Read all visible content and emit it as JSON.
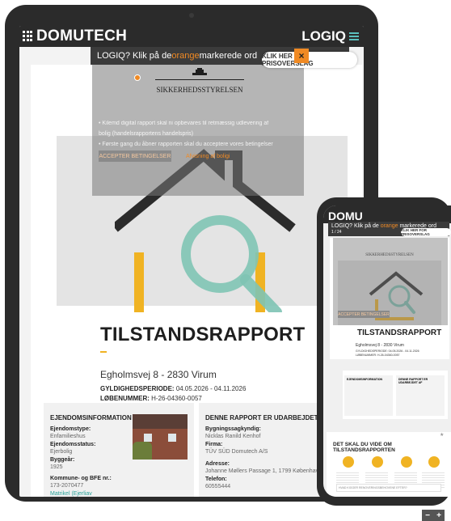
{
  "tablet": {
    "brand": "DOMUTECH",
    "logiq": "LOGIQ",
    "viewer_prefix": "LOGIQ? Klik på de ",
    "viewer_highlight": "orange",
    "viewer_suffix": " markerede ord",
    "cta_label": "KLIK HER FOR PRISOVERSLAG",
    "cta_close": "×",
    "overlay": {
      "agency": "SIKKERHEDSSTYRELSEN",
      "line1": "• Kilemd digital rapport skal ni opbevares til retmæssig udlevering af",
      "line2": "  bolig (handelsrapportens handelspris)",
      "line3": "• Første gang du åbner rapporten skal du acceptere vores betingelser",
      "accept_label": "ACCEPTER BETINGELSER",
      "decline_label": "Afvisning af boligi"
    },
    "report": {
      "title": "TILSTANDSRAPPORT",
      "address": "Egholmsvej 8 - 2830 Virum",
      "period_label": "GYLDIGHEDSPERIODE:",
      "period_value": "04.05.2026 - 04.11.2026",
      "lob_label": "LØBENUMMER:",
      "lob_value": "H-26-04360-0057"
    },
    "property_info": {
      "heading": "EJENDOMSINFORMATION",
      "type_label": "Ejendomstype:",
      "type_value": "Enfamilieshus",
      "status_label": "Ejendomsstatus:",
      "status_value": "Ejerbolig",
      "year_label": "Byggeår:",
      "year_value": "1925",
      "bfe_label": "Kommune- og BFE nr.:",
      "bfe_value": "173-2070477",
      "link": "Matrikel (Ejerliav"
    },
    "prepared_by": {
      "heading": "DENNE RAPPORT ER UDARBEJDET AF",
      "expert_label": "Bygningssagkyndig:",
      "expert_value": "Nicklas Ranild Kenhof",
      "firm_label": "Firma:",
      "firm_value": "TÜV SÜD Domutech A/S",
      "address_label": "Adresse:",
      "address_value": "Johanne Møllers Passage 1, 1799 København",
      "phone_label": "Telefon:",
      "phone_value": "60555444"
    }
  },
  "phone": {
    "brand": "DOMU",
    "viewer_prefix": "LOGIQ? Klik på de ",
    "viewer_highlight": "orange",
    "viewer_suffix": " markerede ord",
    "page_label": "1 / 24",
    "cta_label": "KLIK HER FOR PRISOVERSLAG",
    "agency": "SIKKERHEDSSTYRELSEN",
    "accept_label": "ACCEPTER BETINGELSER",
    "title": "TILSTANDSRAPPORT",
    "address": "Egholmsvej 8 - 2830 Virum",
    "period": "GYLDIGHEDSPERIODE: 04.05.2026 - 04.11.2026",
    "lob": "LØBENUMMER: H-26-04360-0057",
    "info_left": "EJENDOMSINFORMATION",
    "info_right": "DENNE RAPPORT ER UDARBEJDET AF",
    "section_title": "DET SKAL DU VIDE OM TILSTANDSRAPPORTEN",
    "search_placeholder": "HVAD KIGGER RENOVERINGSBEHOVENE EFTER?",
    "zoom_minus": "−",
    "zoom_plus": "+",
    "star": "★"
  },
  "colors": {
    "accent_orange": "#f08a24",
    "accent_yellow": "#f0b323",
    "teal": "#7fc4b4",
    "dark": "#2b2b2b"
  }
}
